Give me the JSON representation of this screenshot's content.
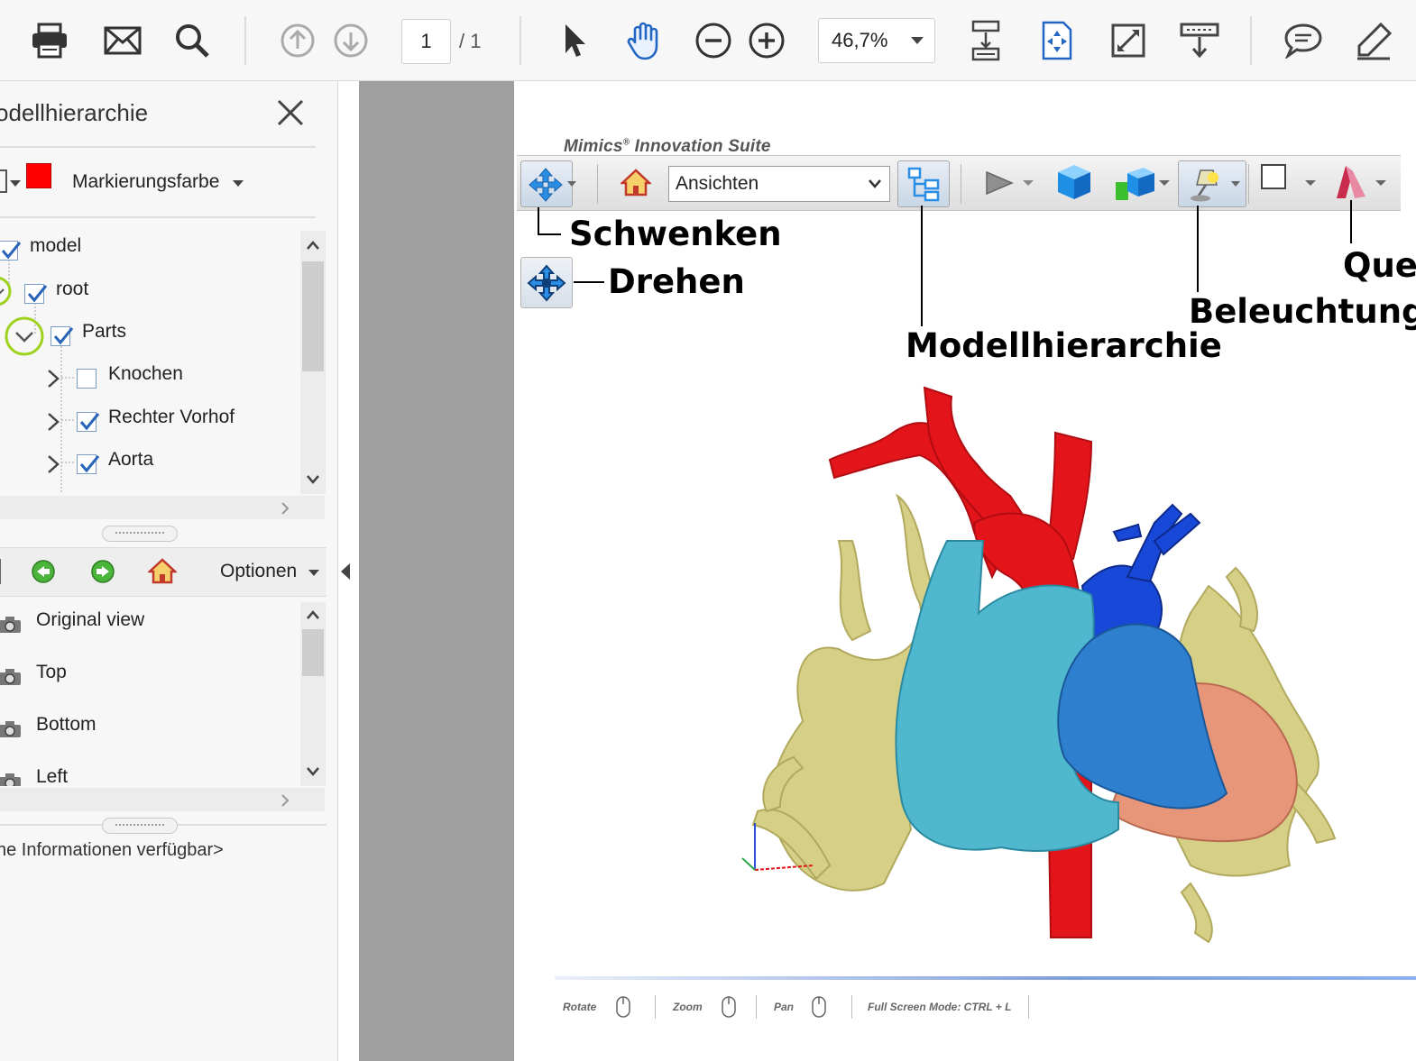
{
  "toolbar": {
    "page_current": "1",
    "page_total": "/ 1",
    "zoom": "46,7%",
    "icons": [
      "print-icon",
      "mail-icon",
      "search-icon",
      "page-up-icon",
      "page-down-icon",
      "select-cursor-icon",
      "hand-tool-icon",
      "zoom-out-icon",
      "zoom-in-icon",
      "scroll-mode-icon",
      "fit-page-icon",
      "fullscreen-icon",
      "read-mode-icon",
      "comment-icon",
      "sign-icon"
    ]
  },
  "left_panel": {
    "title": "odellhierarchie",
    "highlight_color_label": "Markierungsfarbe",
    "highlight_color": "#ff0000",
    "tree": [
      {
        "label": "model",
        "checked": true
      },
      {
        "label": "root",
        "checked": true
      },
      {
        "label": "Parts",
        "checked": true
      },
      {
        "label": "Knochen",
        "checked": false
      },
      {
        "label": "Rechter Vorhof",
        "checked": true
      },
      {
        "label": "Aorta",
        "checked": true
      }
    ],
    "views_options_label": "Optionen",
    "views": [
      "Original view",
      "Top",
      "Bottom",
      "Left"
    ],
    "info": "ne Informationen verfügbar>"
  },
  "document": {
    "brand": "Mimics",
    "brand_rest": " Innovation Suite",
    "views_select": "Ansichten",
    "callouts": {
      "schwenken": "Schwenken",
      "drehen": "Drehen",
      "modellhierarchie": "Modellhierarchie",
      "beleuchtung": "Beleuchtung",
      "quer": "Quer"
    },
    "hints": {
      "rotate": "Rotate",
      "zoom": "Zoom",
      "pan": "Pan",
      "fullscreen": "Full Screen Mode:  CTRL + L"
    }
  },
  "colors": {
    "aorta": "#e4141b",
    "atrium": "#4fb8cf",
    "ventricle": "#2f7fcf",
    "artery": "#1848d8",
    "lung": "#d6cf86",
    "tissue": "#e8967a",
    "accent": "#2f6fd0"
  }
}
